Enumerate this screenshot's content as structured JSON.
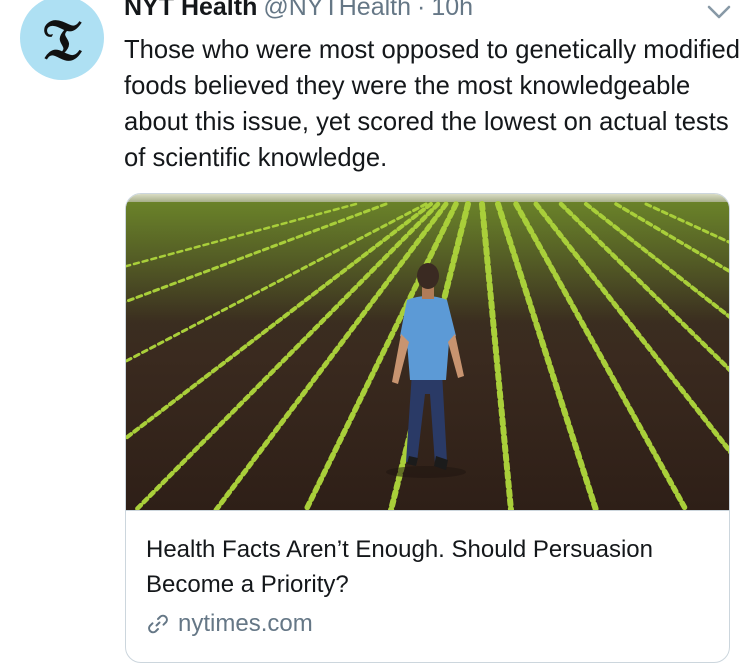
{
  "author": {
    "display_name": "NYT Health",
    "handle": "@NYTHealth",
    "separator": "·",
    "time": "10h",
    "avatar_icon": "nyt-t-logo-icon",
    "avatar_color": "#aee0f3"
  },
  "tweet": {
    "text": "Those who were most opposed to genetically modified foods believed they were the most knowledgeable about this issue, yet scored the lowest on actual tests of scientific knowledge."
  },
  "card": {
    "title": "Health Facts Aren’t Enough. Should Persuasion Become a Priority?",
    "domain": "nytimes.com",
    "domain_icon": "link-icon"
  },
  "menu": {
    "icon": "chevron-down-icon"
  },
  "colors": {
    "text_primary": "#14171a",
    "text_secondary": "#657786",
    "border": "#ccd6dd"
  }
}
